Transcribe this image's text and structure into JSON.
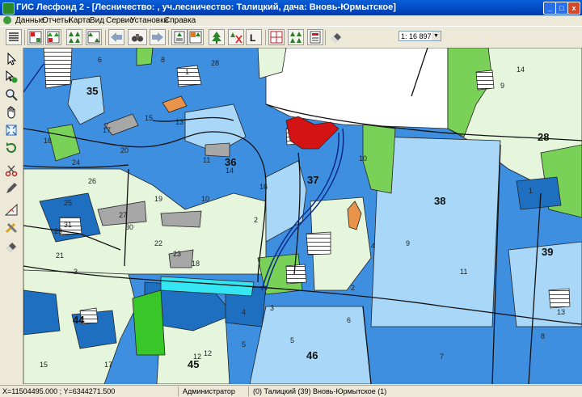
{
  "window": {
    "title": "ГИС Лесфонд 2 - [Лесничество: , уч.лесничество: Талицкий, дача: Вновь-Юрмытское]",
    "min_label": "_",
    "max_label": "□",
    "close_label": "x"
  },
  "menu": {
    "items": [
      "Данные",
      "Отчеты",
      "Карта",
      "Вид",
      "Сервис",
      "Установки",
      "Справка"
    ]
  },
  "toolbar": {
    "scale": "1: 16 897"
  },
  "map": {
    "quarter_labels": [
      "35",
      "36",
      "37",
      "38",
      "28",
      "39",
      "44",
      "45",
      "46"
    ],
    "plot_labels": [
      "6",
      "8",
      "7",
      "17",
      "16",
      "25",
      "24",
      "20",
      "19",
      "21",
      "26",
      "27",
      "31",
      "30",
      "29",
      "28",
      "22",
      "23",
      "11",
      "10",
      "15",
      "13",
      "14",
      "3",
      "9",
      "2",
      "1",
      "4",
      "5",
      "12",
      "18",
      "16",
      "12",
      "14",
      "9",
      "1",
      "3",
      "5",
      "6",
      "7",
      "8",
      "10",
      "4",
      "2",
      "11",
      "13",
      "15",
      "17"
    ]
  },
  "status": {
    "coords": "X=11504495.000 ; Y=6344271.500",
    "user": "Администратор",
    "location": "(0) Талицкий (39)  Вновь-Юрмытское (1)"
  },
  "colors": {
    "mid_blue": "#3f8fe0",
    "light_blue": "#a9d7f7",
    "dark_blue": "#1e6fbf",
    "pale_green": "#e5f6dd",
    "green": "#79d157",
    "bright_green": "#38c628",
    "red": "#d41414",
    "orange": "#e8924a",
    "gray": "#a7a7a7",
    "cyan": "#33e6f2"
  }
}
